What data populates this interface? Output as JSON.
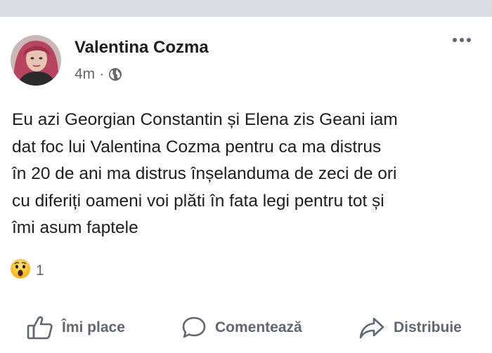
{
  "post": {
    "author": "Valentina Cozma",
    "time": "4m",
    "separator": "·",
    "privacy_icon": "globe-icon",
    "more_icon": "more-options-icon",
    "text_lines": [
      "Eu azi Georgian Constantin și Elena zis Geani iam",
      "dat foc lui Valentina Cozma pentru ca ma distrus",
      "în 20 de  ani ma distrus înșelanduma de zeci de ori",
      "cu diferiți oameni voi plăti în fata legi pentru tot și",
      "îmi asum faptele"
    ]
  },
  "reactions": {
    "icon": "wow-emoji-icon",
    "count": "1"
  },
  "actions": {
    "like_label": "Îmi place",
    "like_icon": "thumbs-up-icon",
    "comment_label": "Comentează",
    "comment_icon": "comment-bubble-icon",
    "share_label": "Distribuie",
    "share_icon": "share-arrow-icon"
  },
  "colors": {
    "background": "#ffffff",
    "top_strip": "#dadde1",
    "text": "#1c1e21",
    "secondary_text": "#65676b",
    "action_text": "#606770"
  }
}
